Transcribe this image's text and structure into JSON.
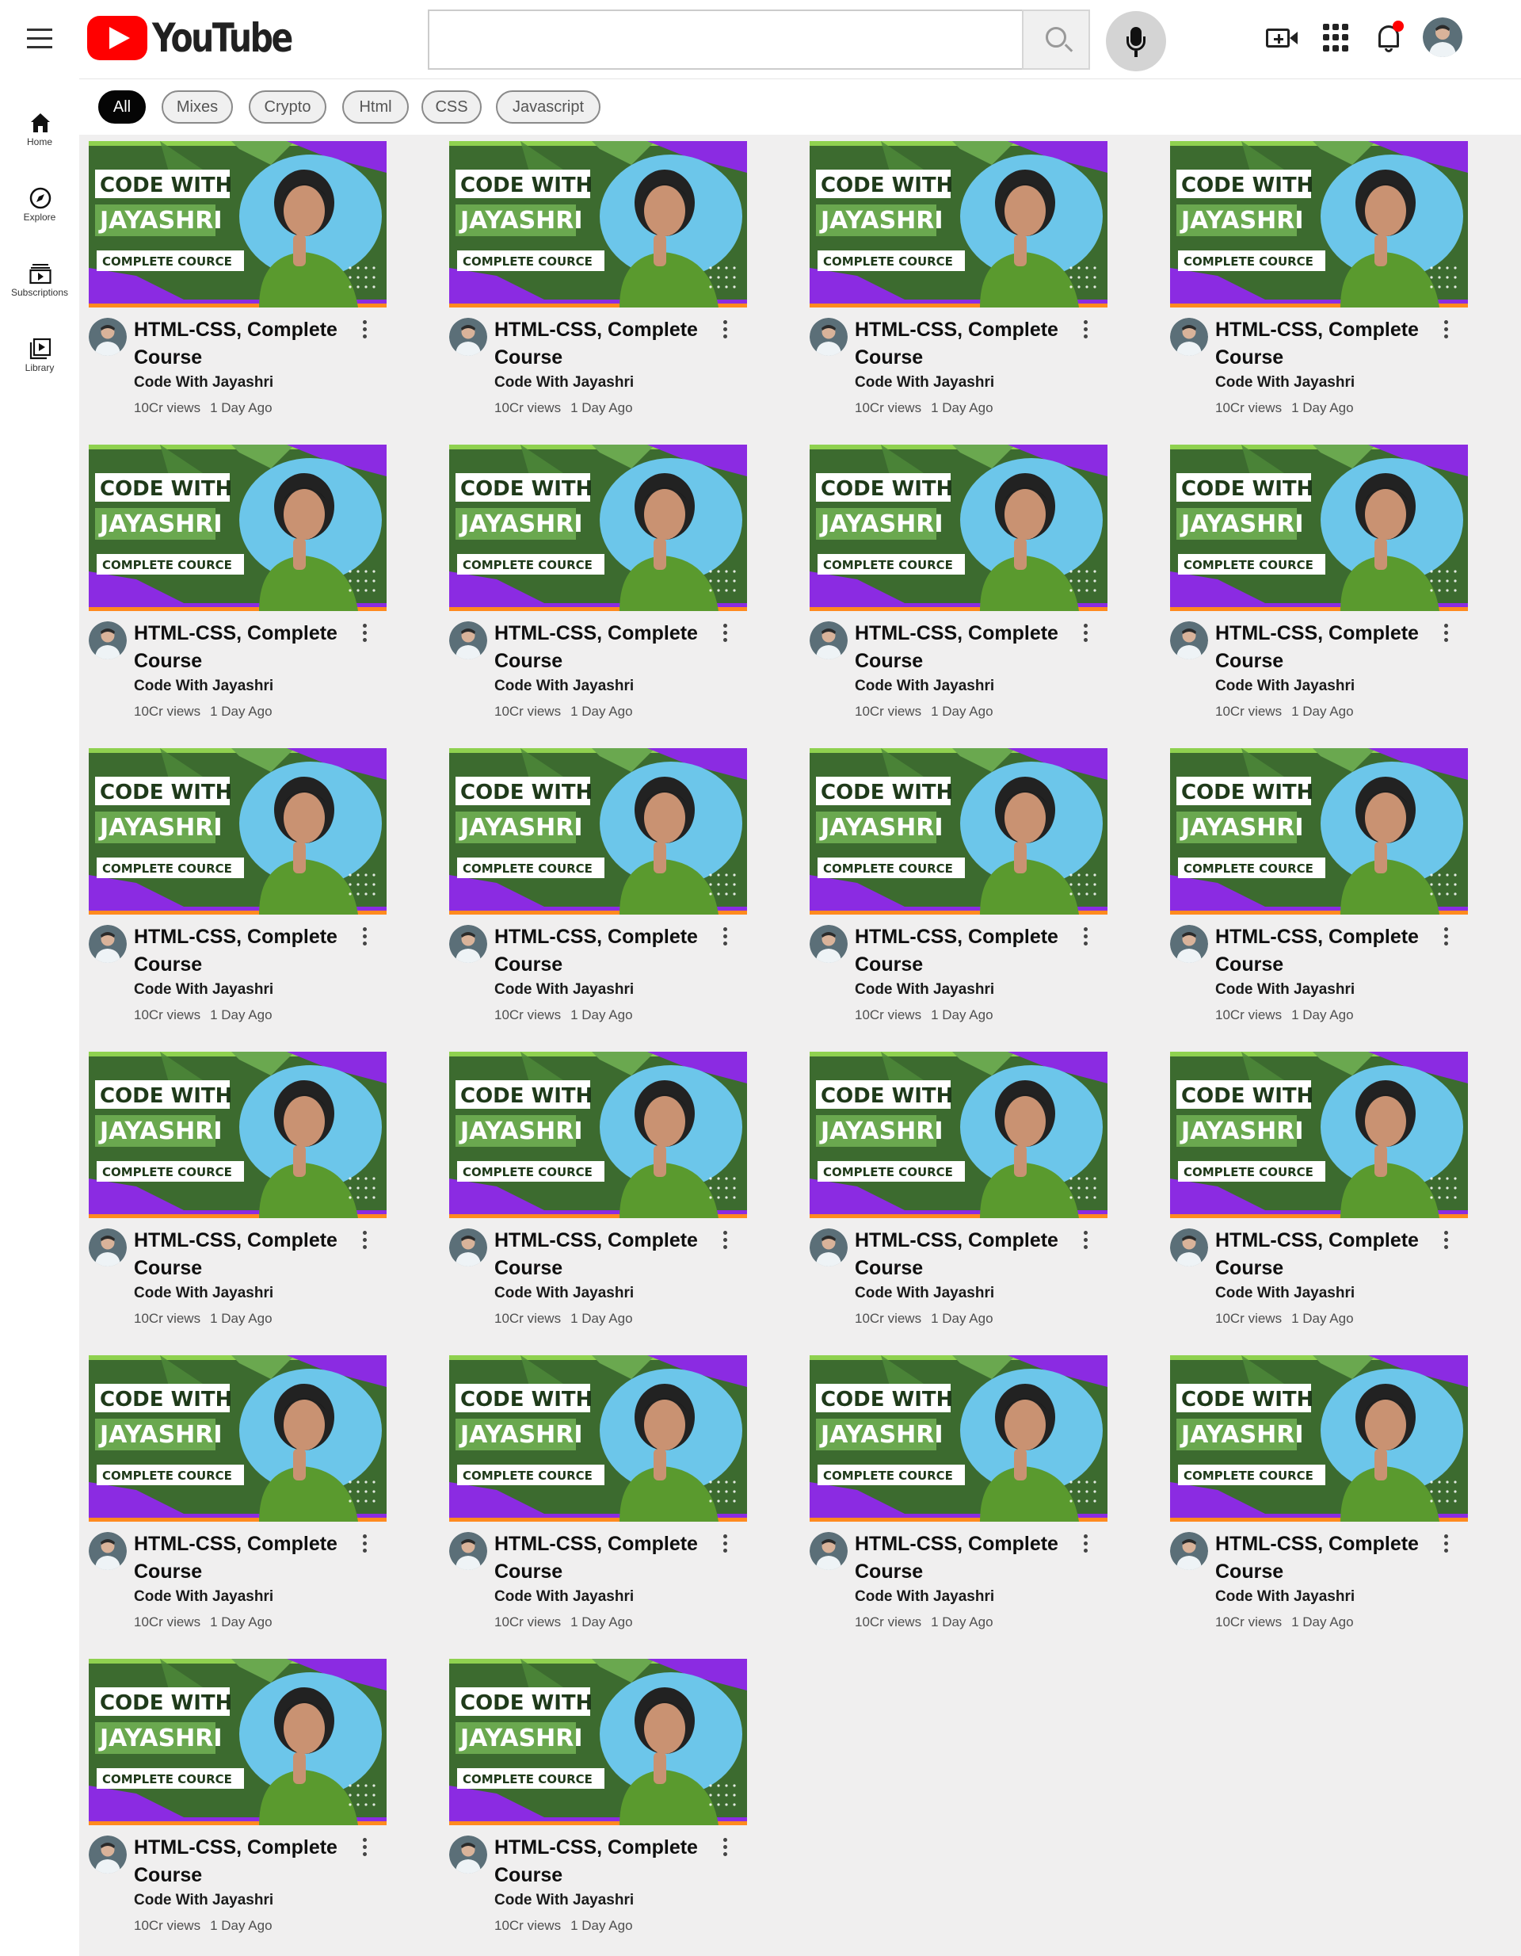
{
  "header": {
    "logo_text": "YouTube",
    "search_placeholder": "",
    "icons": [
      "menu-icon",
      "search-icon",
      "mic-icon",
      "create-video-icon",
      "apps-icon",
      "notifications-icon",
      "avatar"
    ],
    "notification_dot_color": "#ff0000"
  },
  "sidebar": {
    "items": [
      {
        "label": "Home",
        "icon": "home-icon"
      },
      {
        "label": "Explore",
        "icon": "explore-icon"
      },
      {
        "label": "Subscriptions",
        "icon": "subscriptions-icon"
      },
      {
        "label": "Library",
        "icon": "library-icon"
      }
    ]
  },
  "chips": [
    {
      "label": "All",
      "active": true
    },
    {
      "label": "Mixes",
      "active": false
    },
    {
      "label": "Crypto",
      "active": false
    },
    {
      "label": "Html",
      "active": false
    },
    {
      "label": "CSS",
      "active": false
    },
    {
      "label": "Javascript",
      "active": false
    }
  ],
  "thumbnail": {
    "line1": "CODE WITH",
    "line2": "JAYASHRI",
    "line3": "COMPLETE COURCE",
    "colors": {
      "green": "#3c6b2f",
      "purple": "#8b2be2",
      "sky": "#6cc6ea",
      "lime": "#8fd14f",
      "orange": "#ff8a1f"
    }
  },
  "videos": [
    {
      "title": "HTML-CSS, Complete Course",
      "channel": "Code With Jayashri",
      "views": "10Cr views",
      "age": "1 Day Ago"
    },
    {
      "title": "HTML-CSS, Complete Course",
      "channel": "Code With Jayashri",
      "views": "10Cr views",
      "age": "1 Day Ago"
    },
    {
      "title": "HTML-CSS, Complete Course",
      "channel": "Code With Jayashri",
      "views": "10Cr views",
      "age": "1 Day Ago"
    },
    {
      "title": "HTML-CSS, Complete Course",
      "channel": "Code With Jayashri",
      "views": "10Cr views",
      "age": "1 Day Ago"
    },
    {
      "title": "HTML-CSS, Complete Course",
      "channel": "Code With Jayashri",
      "views": "10Cr views",
      "age": "1 Day Ago"
    },
    {
      "title": "HTML-CSS, Complete Course",
      "channel": "Code With Jayashri",
      "views": "10Cr views",
      "age": "1 Day Ago"
    },
    {
      "title": "HTML-CSS, Complete Course",
      "channel": "Code With Jayashri",
      "views": "10Cr views",
      "age": "1 Day Ago"
    },
    {
      "title": "HTML-CSS, Complete Course",
      "channel": "Code With Jayashri",
      "views": "10Cr views",
      "age": "1 Day Ago"
    },
    {
      "title": "HTML-CSS, Complete Course",
      "channel": "Code With Jayashri",
      "views": "10Cr views",
      "age": "1 Day Ago"
    },
    {
      "title": "HTML-CSS, Complete Course",
      "channel": "Code With Jayashri",
      "views": "10Cr views",
      "age": "1 Day Ago"
    },
    {
      "title": "HTML-CSS, Complete Course",
      "channel": "Code With Jayashri",
      "views": "10Cr views",
      "age": "1 Day Ago"
    },
    {
      "title": "HTML-CSS, Complete Course",
      "channel": "Code With Jayashri",
      "views": "10Cr views",
      "age": "1 Day Ago"
    },
    {
      "title": "HTML-CSS, Complete Course",
      "channel": "Code With Jayashri",
      "views": "10Cr views",
      "age": "1 Day Ago"
    },
    {
      "title": "HTML-CSS, Complete Course",
      "channel": "Code With Jayashri",
      "views": "10Cr views",
      "age": "1 Day Ago"
    },
    {
      "title": "HTML-CSS, Complete Course",
      "channel": "Code With Jayashri",
      "views": "10Cr views",
      "age": "1 Day Ago"
    },
    {
      "title": "HTML-CSS, Complete Course",
      "channel": "Code With Jayashri",
      "views": "10Cr views",
      "age": "1 Day Ago"
    },
    {
      "title": "HTML-CSS, Complete Course",
      "channel": "Code With Jayashri",
      "views": "10Cr views",
      "age": "1 Day Ago"
    },
    {
      "title": "HTML-CSS, Complete Course",
      "channel": "Code With Jayashri",
      "views": "10Cr views",
      "age": "1 Day Ago"
    },
    {
      "title": "HTML-CSS, Complete Course",
      "channel": "Code With Jayashri",
      "views": "10Cr views",
      "age": "1 Day Ago"
    },
    {
      "title": "HTML-CSS, Complete Course",
      "channel": "Code With Jayashri",
      "views": "10Cr views",
      "age": "1 Day Ago"
    },
    {
      "title": "HTML-CSS, Complete Course",
      "channel": "Code With Jayashri",
      "views": "10Cr views",
      "age": "1 Day Ago"
    },
    {
      "title": "HTML-CSS, Complete Course",
      "channel": "Code With Jayashri",
      "views": "10Cr views",
      "age": "1 Day Ago"
    }
  ]
}
